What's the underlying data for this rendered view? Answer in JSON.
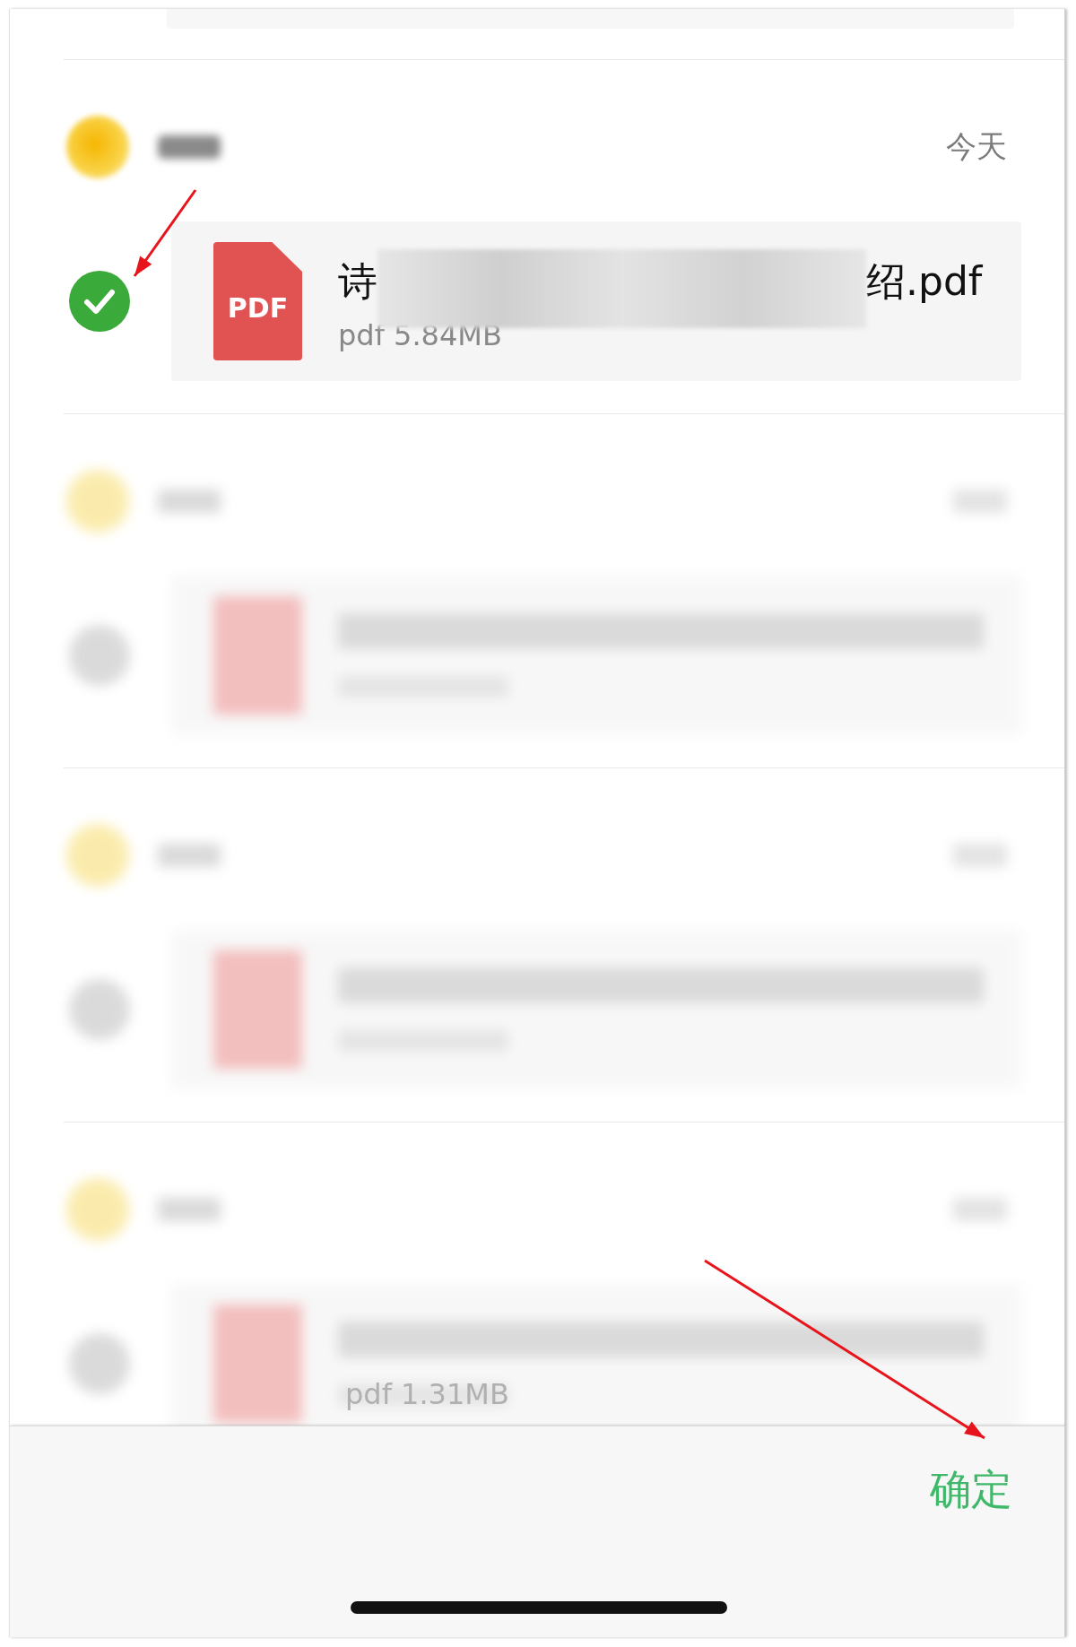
{
  "items": [
    {
      "kind": "clear",
      "checked": true,
      "time": "今天",
      "file": {
        "type_label": "PDF",
        "name_start": "诗",
        "name_end": "绍.pdf",
        "meta": "pdf 5.84MB"
      }
    },
    {
      "kind": "blurred",
      "checked": false
    },
    {
      "kind": "blurred",
      "checked": false
    },
    {
      "kind": "blurred",
      "checked": false,
      "meta": "pdf 1.31MB"
    }
  ],
  "confirm_button": "确定"
}
